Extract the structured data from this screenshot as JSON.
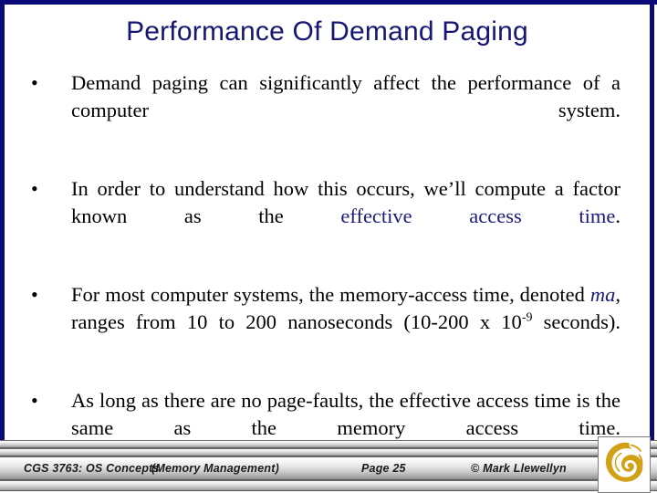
{
  "slide": {
    "title": "Performance Of Demand Paging",
    "title_color": "#161673",
    "accent_color": "#1b1b7a",
    "border_color": "#0a0a78",
    "background": "#ffffff",
    "bullet_glyph": "•"
  },
  "bullets": [
    {
      "id": "bullet-1",
      "segments": [
        {
          "text": "Demand paging can significantly affect the performance of a computer system.",
          "style": "normal"
        }
      ],
      "plain": "Demand paging can significantly affect the performance of a computer system."
    },
    {
      "id": "bullet-2",
      "segments": [
        {
          "text": "In order to understand how this occurs, we’ll compute a factor known as the ",
          "style": "normal"
        },
        {
          "text": "effective access time",
          "style": "accent"
        },
        {
          "text": ".",
          "style": "normal"
        }
      ],
      "plain": "In order to understand how this occurs, we’ll compute a factor known as the effective access time."
    },
    {
      "id": "bullet-3",
      "segments": [
        {
          "text": "For most computer systems, the memory-access time, denoted ",
          "style": "normal"
        },
        {
          "text": "ma",
          "style": "accent-italic"
        },
        {
          "text": ", ranges from 10 to 200 nanoseconds (10-200 x 10",
          "style": "normal"
        },
        {
          "text": "-9",
          "style": "superscript"
        },
        {
          "text": " seconds).",
          "style": "normal"
        }
      ],
      "plain": "For most computer systems, the memory-access time, denoted ma, ranges from 10 to 200 nanoseconds (10-200 x 10-9 seconds)."
    },
    {
      "id": "bullet-4",
      "segments": [
        {
          "text": "As long as there are no page-faults, the effective access time is the same as the memory access time.",
          "style": "normal"
        }
      ],
      "plain": "As long as there are no page-faults, the effective access time is the same as the memory access time."
    }
  ],
  "footer": {
    "course": "CGS 3763: OS Concepts",
    "topic": "(Memory Management)",
    "page": "Page 25",
    "copyright": "© Mark Llewellyn",
    "logo_name": "ucf-pegasus-logo",
    "logo_color": "#d1a016"
  }
}
